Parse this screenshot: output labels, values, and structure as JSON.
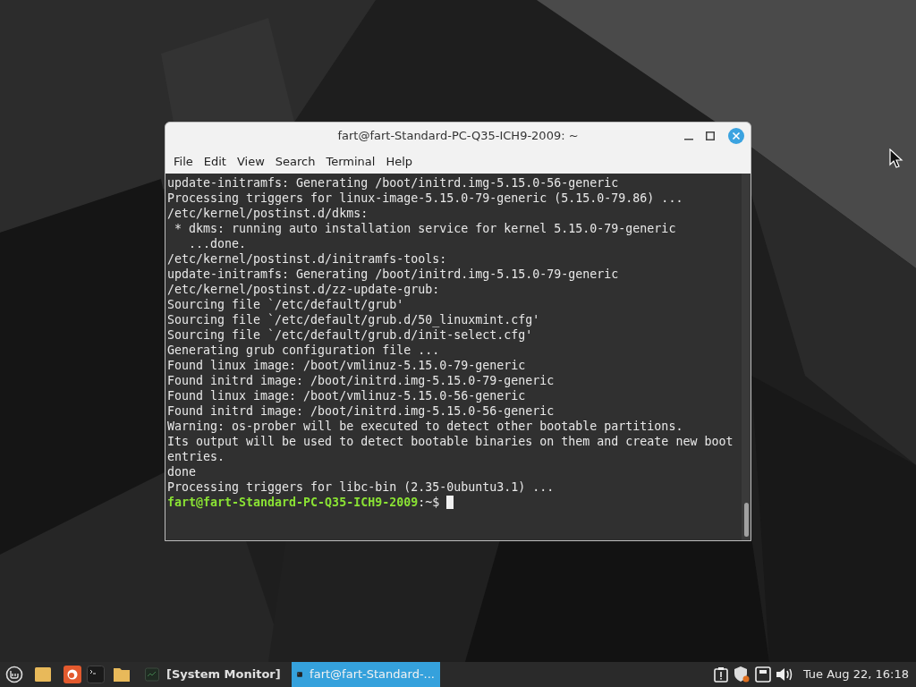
{
  "window": {
    "title": "fart@fart-Standard-PC-Q35-ICH9-2009: ~",
    "menu": [
      "File",
      "Edit",
      "View",
      "Search",
      "Terminal",
      "Help"
    ]
  },
  "terminal": {
    "lines": [
      "update-initramfs: Generating /boot/initrd.img-5.15.0-56-generic",
      "Processing triggers for linux-image-5.15.0-79-generic (5.15.0-79.86) ...",
      "/etc/kernel/postinst.d/dkms:",
      " * dkms: running auto installation service for kernel 5.15.0-79-generic",
      "   ...done.",
      "/etc/kernel/postinst.d/initramfs-tools:",
      "update-initramfs: Generating /boot/initrd.img-5.15.0-79-generic",
      "/etc/kernel/postinst.d/zz-update-grub:",
      "Sourcing file `/etc/default/grub'",
      "Sourcing file `/etc/default/grub.d/50_linuxmint.cfg'",
      "Sourcing file `/etc/default/grub.d/init-select.cfg'",
      "Generating grub configuration file ...",
      "Found linux image: /boot/vmlinuz-5.15.0-79-generic",
      "Found initrd image: /boot/initrd.img-5.15.0-79-generic",
      "Found linux image: /boot/vmlinuz-5.15.0-56-generic",
      "Found initrd image: /boot/initrd.img-5.15.0-56-generic",
      "Warning: os-prober will be executed to detect other bootable partitions.",
      "Its output will be used to detect bootable binaries on them and create new boot",
      "entries.",
      "done",
      "Processing triggers for libc-bin (2.35-0ubuntu3.1) ..."
    ],
    "prompt": {
      "user_host": "fart@fart-Standard-PC-Q35-ICH9-2009",
      "path": ":~$"
    },
    "cursor": true
  },
  "taskbar": {
    "windows": [
      {
        "label": "[System Monitor]",
        "kind": "monitor",
        "selected": false
      },
      {
        "label": "fart@fart-Standard-...",
        "kind": "terminal",
        "selected": true
      }
    ],
    "clock": "Tue Aug 22, 16:18"
  }
}
